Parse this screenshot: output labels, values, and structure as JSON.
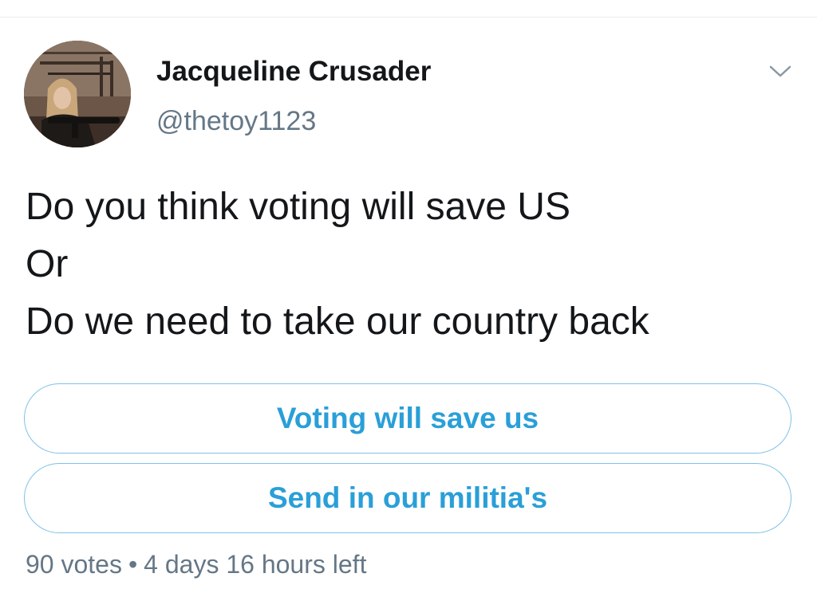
{
  "tweet": {
    "author": {
      "display_name": "Jacqueline Crusader",
      "handle": "@thetoy1123"
    },
    "text_lines": [
      "Do you think voting will save US",
      "Or",
      "Do we need to take our country back"
    ],
    "menu_icon": "chevron-down-icon"
  },
  "poll": {
    "options": [
      {
        "label": "Voting will save us"
      },
      {
        "label": "Send in our militia's"
      }
    ],
    "votes": "90 votes",
    "separator": "•",
    "time_left": "4 days 16 hours left"
  },
  "colors": {
    "accent": "#2a9fd8",
    "poll_border": "#7fc1e8",
    "secondary_text": "#657786",
    "primary_text": "#14171a"
  }
}
